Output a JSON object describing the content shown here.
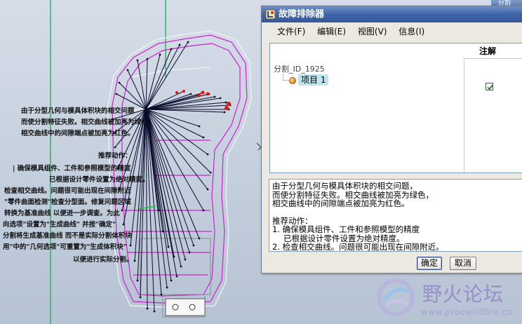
{
  "background_window": {
    "title": "分割"
  },
  "cad_notes": {
    "lines": [
      "由于分型几何与模具体积块的相交问题",
      "而使分割特征失败。相交曲线被加亮为绿色",
      "相交曲线中的间隙端点被加亮为红色。",
      "推荐动作：",
      "|  确保模具组件、工件和参照模型的精度",
      "已根据设计零件设置为绝对精度。",
      "检查相交曲线。问题很可能出现在间隙附近",
      "\"零件曲面检测\"检查分型面。修复问题区域",
      "转换为基准曲线  以便进一步调查。为此",
      "向选项\"设置为\"生成曲线\"  并按\"确定\"",
      "分割将生成基准曲线  而不是实际分割体积块",
      "用\"中的\"几何选项\"可重置为\"生成体积块\"",
      "以便进行实际分割。"
    ]
  },
  "dialog": {
    "title": "故障排除器",
    "menu": [
      "文件(F)",
      "编辑(E)",
      "视图(V)",
      "信息(I)"
    ],
    "column_header": "注解",
    "tree_root": "分割_ID_1925",
    "tree_item": "项目 1",
    "item_checked": true,
    "message": {
      "l1": "由于分型几何与模具体积块的相交问题，",
      "l2": "而使分割特征失败。相交曲线被加亮为绿色，",
      "l3": "相交曲线中的间隙端点被加亮为红色。",
      "l4": "推荐动作：",
      "l5": "1. 确保模具组件、工件和参照模型的精度",
      "l6": "已根据设计零件设置为绝对精度。",
      "l7": "2. 检查相交曲线。问题很可能出现在间隙附近。"
    },
    "ok_label": "确定",
    "cancel_label": "取消"
  },
  "watermark": {
    "name": "野火论坛",
    "url": "www.proewildfire.cn"
  },
  "colors": {
    "accent_title": "#3e64a8",
    "model_outline": "#d01fd0",
    "ray_color": "#0a0a2a",
    "highlight_red": "#e01818"
  }
}
